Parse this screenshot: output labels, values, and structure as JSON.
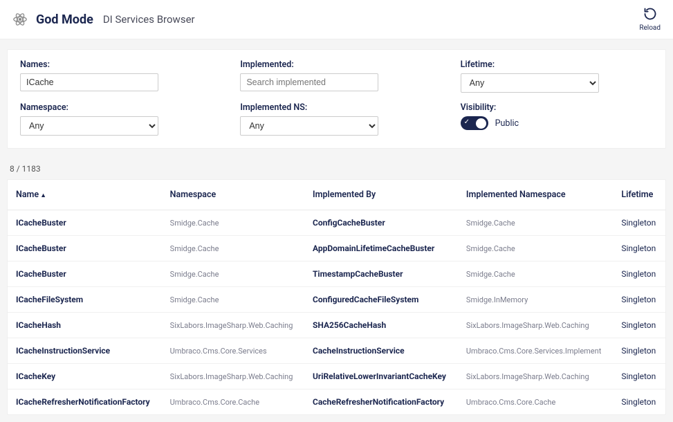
{
  "header": {
    "title": "God Mode",
    "subtitle": "DI Services Browser",
    "reload_label": "Reload"
  },
  "filters": {
    "names_label": "Names:",
    "names_value": "ICache",
    "implemented_label": "Implemented:",
    "implemented_placeholder": "Search implemented",
    "lifetime_label": "Lifetime:",
    "lifetime_value": "Any",
    "namespace_label": "Namespace:",
    "namespace_value": "Any",
    "implemented_ns_label": "Implemented NS:",
    "implemented_ns_value": "Any",
    "visibility_label": "Visibility:",
    "visibility_value": "Public"
  },
  "count": {
    "shown": 8,
    "total": 1183
  },
  "table": {
    "columns": {
      "name": "Name",
      "namespace": "Namespace",
      "impl_by": "Implemented By",
      "impl_ns": "Implemented Namespace",
      "lifetime": "Lifetime"
    },
    "sort_arrow": "▲",
    "rows": [
      {
        "name": "ICacheBuster",
        "ns": "Smidge.Cache",
        "impl": "ConfigCacheBuster",
        "implns": "Smidge.Cache",
        "life": "Singleton"
      },
      {
        "name": "ICacheBuster",
        "ns": "Smidge.Cache",
        "impl": "AppDomainLifetimeCacheBuster",
        "implns": "Smidge.Cache",
        "life": "Singleton"
      },
      {
        "name": "ICacheBuster",
        "ns": "Smidge.Cache",
        "impl": "TimestampCacheBuster",
        "implns": "Smidge.Cache",
        "life": "Singleton"
      },
      {
        "name": "ICacheFileSystem",
        "ns": "Smidge.Cache",
        "impl": "ConfiguredCacheFileSystem",
        "implns": "Smidge.InMemory",
        "life": "Singleton"
      },
      {
        "name": "ICacheHash",
        "ns": "SixLabors.ImageSharp.Web.Caching",
        "impl": "SHA256CacheHash",
        "implns": "SixLabors.ImageSharp.Web.Caching",
        "life": "Singleton"
      },
      {
        "name": "ICacheInstructionService",
        "ns": "Umbraco.Cms.Core.Services",
        "impl": "CacheInstructionService",
        "implns": "Umbraco.Cms.Core.Services.Implement",
        "life": "Singleton"
      },
      {
        "name": "ICacheKey",
        "ns": "SixLabors.ImageSharp.Web.Caching",
        "impl": "UriRelativeLowerInvariantCacheKey",
        "implns": "SixLabors.ImageSharp.Web.Caching",
        "life": "Singleton"
      },
      {
        "name": "ICacheRefresherNotificationFactory",
        "ns": "Umbraco.Cms.Core.Cache",
        "impl": "CacheRefresherNotificationFactory",
        "implns": "Umbraco.Cms.Core.Cache",
        "life": "Singleton"
      }
    ]
  }
}
